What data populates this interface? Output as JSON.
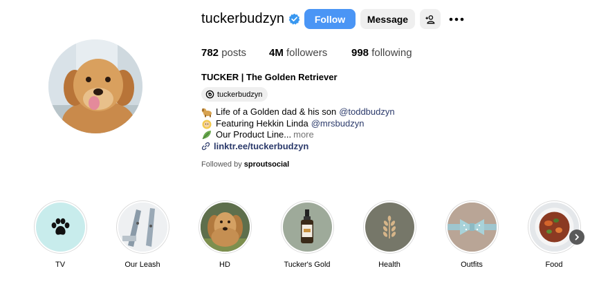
{
  "profile": {
    "username": "tuckerbudzyn",
    "verified": true,
    "full_name": "TUCKER | The Golden Retriever",
    "threads_handle": "tuckerbudzyn"
  },
  "actions": {
    "follow_label": "Follow",
    "message_label": "Message"
  },
  "stats": {
    "posts_count": "782",
    "posts_label": "posts",
    "followers_count": "4M",
    "followers_label": "followers",
    "following_count": "998",
    "following_label": "following"
  },
  "bio": {
    "line1_text": "Life of a Golden dad & his son ",
    "line1_mention": "@toddbudzyn",
    "line2_text": "Featuring Hekkin Linda ",
    "line2_mention": "@mrsbudzyn",
    "line3_text": "Our Product Line...",
    "line3_more": "more",
    "link_text": "linktr.ee/tuckerbudzyn"
  },
  "followed_by": {
    "prefix": "Followed by",
    "user": "sproutsocial"
  },
  "highlights": [
    {
      "label": "TV"
    },
    {
      "label": "Our Leash"
    },
    {
      "label": "HD"
    },
    {
      "label": "Tucker's Gold"
    },
    {
      "label": "Health"
    },
    {
      "label": "Outfits"
    },
    {
      "label": "Food"
    }
  ],
  "colors": {
    "follow_button": "#4a95f5",
    "secondary_button": "#efefef",
    "mention_link": "#2b3a6b",
    "verified_badge": "#3897f0"
  },
  "icons": {
    "verified": "verified-badge-icon",
    "add_user": "add-user-icon",
    "more": "more-options-icon",
    "threads": "threads-icon",
    "link": "link-icon",
    "next": "chevron-right-icon"
  }
}
